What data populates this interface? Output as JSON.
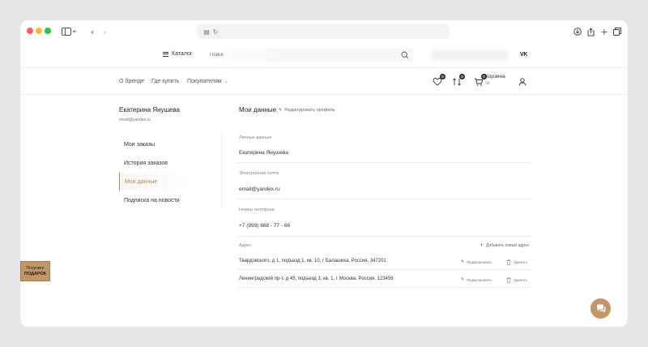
{
  "header": {
    "catalog_label": "Каталог",
    "search_placeholder": "Поиск",
    "social_label": "VK"
  },
  "subnav": {
    "items": [
      "О бренде",
      "Где купить",
      "Покупателям"
    ],
    "favorites_count": "0",
    "compare_count": "0",
    "cart_count": "0",
    "cart_label": "Корзина",
    "cart_sum": "0₽"
  },
  "profile": {
    "name": "Екатерина Янушева",
    "email": "email@yandex.ru"
  },
  "side_menu": {
    "items": [
      "Мои заказы",
      "История заказов",
      "Мои данные",
      "Подписка на новости"
    ],
    "active_index": 2
  },
  "content": {
    "title": "Мои данные",
    "edit_profile": "Редактировать профиль",
    "fields": [
      {
        "label": "Личные данные",
        "value": "Екатерина Янушева"
      },
      {
        "label": "Электронная почта",
        "value": "email@yandex.ru"
      },
      {
        "label": "Номер телефона",
        "value": "+7 (999) 888 - 77 - 66"
      }
    ],
    "address_label": "Адрес",
    "add_address": "Добавить новый адрес",
    "addresses": [
      "Твардовского, д 1, подъезд 1, кв. 10, г Балашиха, Россия, 347201",
      "Ленинградский пр-т, д 45, подъезд 3, кв. 1, г Москва, Россия, 123456"
    ],
    "edit_label": "Редактировать",
    "delete_label": "Удалить"
  },
  "gift": {
    "line1": "Получите",
    "line2": "ПОДАРОК"
  },
  "colors": {
    "accent": "#c39667",
    "active_text": "#b08a55"
  }
}
